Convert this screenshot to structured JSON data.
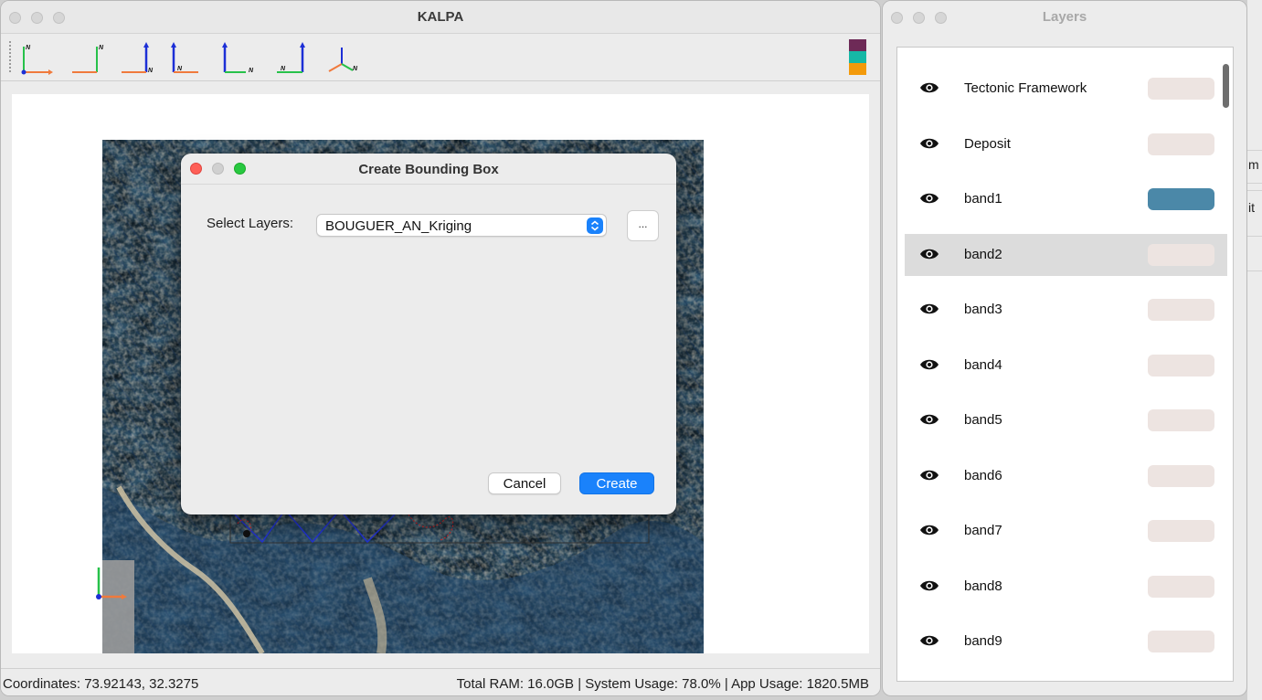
{
  "main_window": {
    "title": "KALPA",
    "toolbar": {
      "view_buttons": [
        {
          "icon": "axis-view-1-icon",
          "n_label": "N"
        },
        {
          "icon": "axis-view-2-icon",
          "n_label": "N"
        },
        {
          "icon": "axis-view-3-icon",
          "n_label": "N"
        },
        {
          "icon": "axis-view-4-icon",
          "n_label": "N"
        },
        {
          "icon": "axis-view-5-icon",
          "n_label": "N"
        },
        {
          "icon": "axis-view-6-icon",
          "n_label": "N"
        },
        {
          "icon": "axis-view-3d-icon",
          "n_label": "N"
        }
      ],
      "swatch_colors": [
        "#6e2a57",
        "#16b8a6",
        "#f39a0b"
      ]
    },
    "axis_colors": {
      "x": "#f07a3c",
      "y": "#27c14a",
      "z": "#1c2fd6"
    },
    "statusbar": {
      "coordinates": "Coordinates: 73.92143, 32.3275",
      "usage": "Total RAM: 16.0GB | System Usage: 78.0% | App Usage: 1820.5MB"
    }
  },
  "dialog": {
    "title": "Create Bounding Box",
    "select_label": "Select Layers:",
    "selected_layer": "BOUGUER_AN_Kriging",
    "more_button": "...",
    "cancel_label": "Cancel",
    "create_label": "Create",
    "accent": "#1a82fb"
  },
  "layers_window": {
    "title": "Layers",
    "layers": [
      {
        "name": "Tectonic Framework",
        "color": "#ede4e1",
        "selected": false
      },
      {
        "name": "Deposit",
        "color": "#ede4e1",
        "selected": false
      },
      {
        "name": "band1",
        "color": "#4b88a8",
        "selected": false
      },
      {
        "name": "band2",
        "color": "#ede4e1",
        "selected": true
      },
      {
        "name": "band3",
        "color": "#ede4e1",
        "selected": false
      },
      {
        "name": "band4",
        "color": "#ede4e1",
        "selected": false
      },
      {
        "name": "band5",
        "color": "#ede4e1",
        "selected": false
      },
      {
        "name": "band6",
        "color": "#ede4e1",
        "selected": false
      },
      {
        "name": "band7",
        "color": "#ede4e1",
        "selected": false
      },
      {
        "name": "band8",
        "color": "#ede4e1",
        "selected": false
      },
      {
        "name": "band9",
        "color": "#ede4e1",
        "selected": false
      }
    ]
  },
  "background_window": {
    "fragments": [
      "m",
      "it"
    ]
  }
}
